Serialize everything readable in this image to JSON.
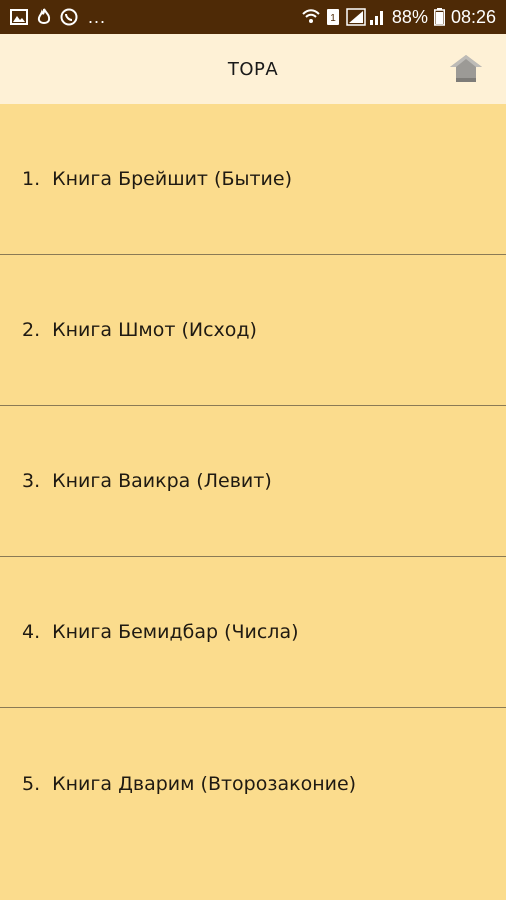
{
  "status_bar": {
    "battery": "88%",
    "time": "08:26",
    "dots": "...",
    "icons": [
      "image-icon",
      "fire-icon",
      "viber-icon",
      "wifi-icon",
      "sim-icon",
      "signal-icon",
      "battery-icon"
    ]
  },
  "app_bar": {
    "title": "ТОРА",
    "home_icon": "home-icon"
  },
  "books": [
    {
      "num": "1.",
      "title": "Книга Брейшит (Бытие)"
    },
    {
      "num": "2.",
      "title": "Книга Шмот (Исход)"
    },
    {
      "num": "3.",
      "title": "Книга Ваикра (Левит)"
    },
    {
      "num": "4.",
      "title": "Книга Бемидбар (Числа)"
    },
    {
      "num": "5.",
      "title": "Книга Дварим (Второзаконие)"
    }
  ],
  "colors": {
    "status_bar_bg": "#4E2A06",
    "app_bar_bg": "#FEF1D6",
    "list_bg": "#FBDC8D",
    "divider": "#8A7A55"
  }
}
